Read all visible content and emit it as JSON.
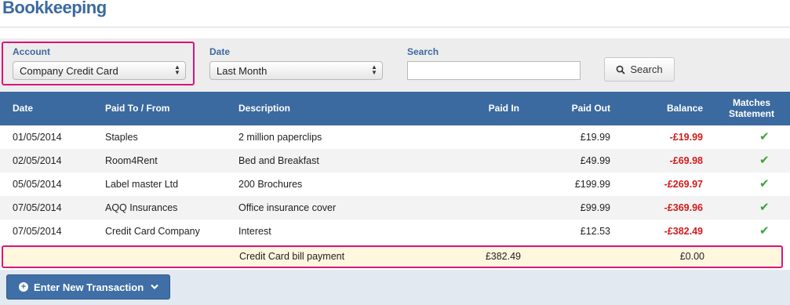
{
  "page": {
    "title": "Bookkeeping"
  },
  "filters": {
    "account": {
      "label": "Account",
      "value": "Company Credit Card"
    },
    "date": {
      "label": "Date",
      "value": "Last Month"
    },
    "search": {
      "label": "Search",
      "value": "",
      "placeholder": "",
      "button_label": "Search"
    }
  },
  "table": {
    "columns": {
      "date": "Date",
      "paid_to_from": "Paid To / From",
      "description": "Description",
      "paid_in": "Paid In",
      "paid_out": "Paid Out",
      "balance": "Balance",
      "matches_line1": "Matches",
      "matches_line2": "Statement"
    },
    "rows": [
      {
        "date": "01/05/2014",
        "paid_to_from": "Staples",
        "description": "2 million paperclips",
        "paid_in": "",
        "paid_out": "£19.99",
        "balance": "-£19.99",
        "matches": "✔"
      },
      {
        "date": "02/05/2014",
        "paid_to_from": "Room4Rent",
        "description": "Bed and Breakfast",
        "paid_in": "",
        "paid_out": "£49.99",
        "balance": "-£69.98",
        "matches": "✔"
      },
      {
        "date": "05/05/2014",
        "paid_to_from": "Label master Ltd",
        "description": "200 Brochures",
        "paid_in": "",
        "paid_out": "£199.99",
        "balance": "-£269.97",
        "matches": "✔"
      },
      {
        "date": "07/05/2014",
        "paid_to_from": "AQQ Insurances",
        "description": "Office insurance cover",
        "paid_in": "",
        "paid_out": "£99.99",
        "balance": "-£369.96",
        "matches": "✔"
      },
      {
        "date": "07/05/2014",
        "paid_to_from": "Credit Card Company",
        "description": "Interest",
        "paid_in": "",
        "paid_out": "£12.53",
        "balance": "-£382.49",
        "matches": "✔"
      }
    ],
    "pending_row": {
      "description": "Credit Card bill payment",
      "paid_in": "£382.49",
      "balance": "£0.00"
    }
  },
  "footer": {
    "new_transaction_label": "Enter New Transaction"
  },
  "colors": {
    "accent": "#3b6aa0",
    "highlight": "#d9157a",
    "negative": "#d41b1b",
    "check": "#3aa33a",
    "pending_bg": "#fff6de"
  },
  "icons": {
    "search": "magnifier-icon",
    "add": "plus-circle-icon",
    "dropdown": "chevron-down-icon",
    "match": "checkmark-icon"
  }
}
